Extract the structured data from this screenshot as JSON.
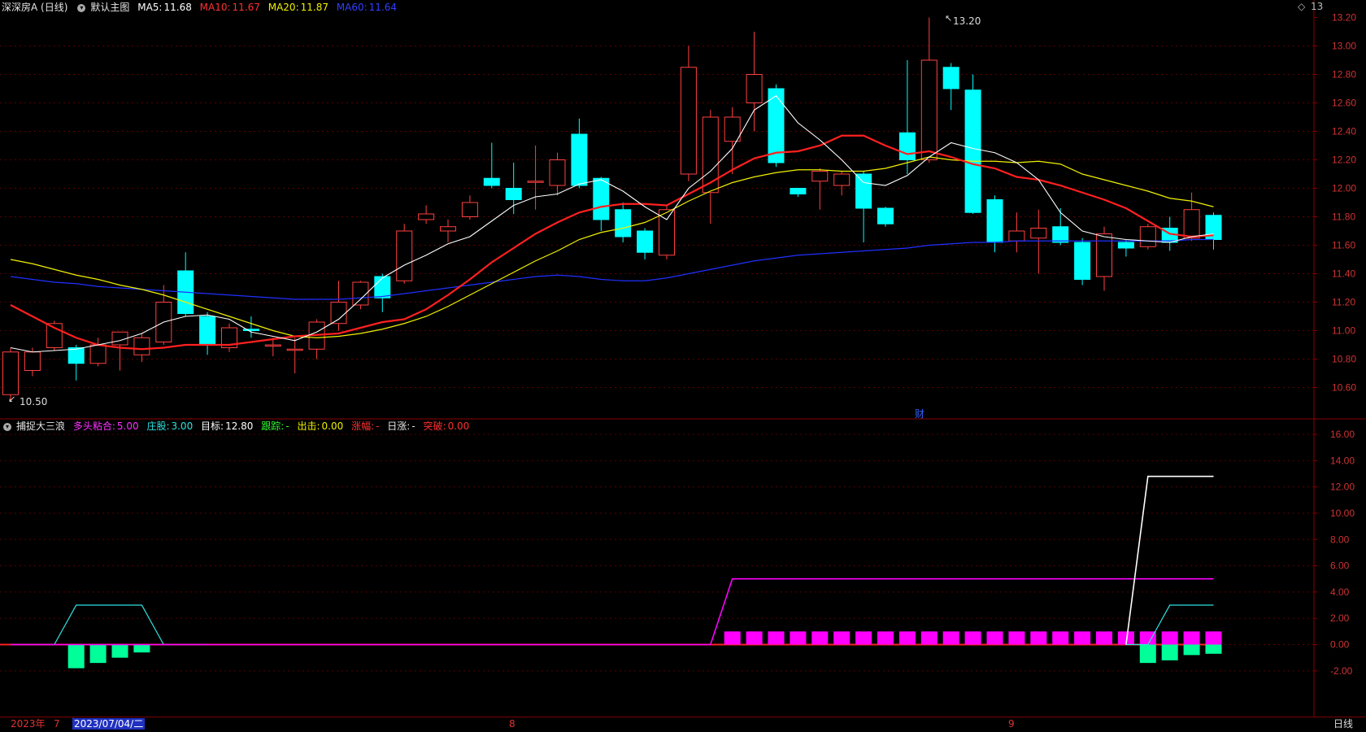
{
  "header": {
    "stock": "深深房A (日线)",
    "main_chart": "默认主图",
    "ma5_label": "MA5:",
    "ma5": "11.68",
    "ma10_label": "MA10:",
    "ma10": "11.67",
    "ma20_label": "MA20:",
    "ma20": "11.87",
    "ma60_label": "MA60:",
    "ma60": "11.64",
    "colors": {
      "ma5": "#ffffff",
      "ma10": "#ff2020",
      "ma20": "#f0f000",
      "ma60": "#2030ff"
    }
  },
  "indicator_header": {
    "name": "捕捉大三浪",
    "duotou_label": "多头粘合:",
    "duotou": "5.00",
    "zhuang_label": "庄股:",
    "zhuang": "3.00",
    "target_label": "目标:",
    "target": "12.80",
    "track_label": "跟踪:",
    "track": "-",
    "out_label": "出击:",
    "out": "0.00",
    "rise_label": "涨幅:",
    "rise": "-",
    "day_label": "日涨:",
    "day": "-",
    "break_label": "突破:",
    "break": "0.00"
  },
  "price_labels": {
    "high": "13.20",
    "low": "10.50",
    "event": "财"
  },
  "top_right": {
    "icon": "diamond-icon",
    "value": "13"
  },
  "bottom_bar": {
    "year": "2023年",
    "m7": "7",
    "date": "2023/07/04/二",
    "m8": "8",
    "m9": "9",
    "period": "日线"
  },
  "chart_data": [
    {
      "type": "candlestick",
      "ylim": [
        10.5,
        13.2
      ],
      "y_ticks": [
        "13.20",
        "13.00",
        "12.80",
        "12.60",
        "12.40",
        "12.20",
        "12.00",
        "11.80",
        "11.60",
        "11.40",
        "11.20",
        "11.00",
        "10.80",
        "10.60"
      ],
      "candles": [
        {
          "o": 10.55,
          "c": 10.85,
          "h": 10.88,
          "l": 10.5
        },
        {
          "o": 10.72,
          "c": 10.85,
          "h": 10.88,
          "l": 10.68
        },
        {
          "o": 10.88,
          "c": 11.05,
          "h": 11.07,
          "l": 10.86
        },
        {
          "o": 10.88,
          "c": 10.77,
          "h": 10.9,
          "l": 10.65
        },
        {
          "o": 10.77,
          "c": 10.9,
          "h": 10.95,
          "l": 10.75
        },
        {
          "o": 10.9,
          "c": 10.99,
          "h": 10.99,
          "l": 10.72
        },
        {
          "o": 10.83,
          "c": 10.95,
          "h": 10.98,
          "l": 10.78
        },
        {
          "o": 10.92,
          "c": 11.2,
          "h": 11.32,
          "l": 10.9
        },
        {
          "o": 11.42,
          "c": 11.12,
          "h": 11.55,
          "l": 11.1
        },
        {
          "o": 11.1,
          "c": 10.9,
          "h": 11.13,
          "l": 10.83
        },
        {
          "o": 10.88,
          "c": 11.02,
          "h": 11.05,
          "l": 10.85
        },
        {
          "o": 11.01,
          "c": 11.0,
          "h": 11.1,
          "l": 10.95
        },
        {
          "o": 10.9,
          "c": 10.9,
          "h": 10.95,
          "l": 10.82
        },
        {
          "o": 10.87,
          "c": 10.87,
          "h": 10.95,
          "l": 10.7
        },
        {
          "o": 10.87,
          "c": 11.06,
          "h": 11.08,
          "l": 10.8
        },
        {
          "o": 11.05,
          "c": 11.2,
          "h": 11.35,
          "l": 11.0
        },
        {
          "o": 11.18,
          "c": 11.34,
          "h": 11.35,
          "l": 11.15
        },
        {
          "o": 11.38,
          "c": 11.23,
          "h": 11.4,
          "l": 11.13
        },
        {
          "o": 11.35,
          "c": 11.7,
          "h": 11.75,
          "l": 11.33
        },
        {
          "o": 11.78,
          "c": 11.82,
          "h": 11.88,
          "l": 11.75
        },
        {
          "o": 11.7,
          "c": 11.73,
          "h": 11.78,
          "l": 11.62
        },
        {
          "o": 11.8,
          "c": 11.9,
          "h": 11.95,
          "l": 11.78
        },
        {
          "o": 12.07,
          "c": 12.02,
          "h": 12.32,
          "l": 12.0
        },
        {
          "o": 12.0,
          "c": 11.92,
          "h": 12.18,
          "l": 11.82
        },
        {
          "o": 12.05,
          "c": 12.05,
          "h": 12.3,
          "l": 11.85
        },
        {
          "o": 12.02,
          "c": 12.2,
          "h": 12.25,
          "l": 11.95
        },
        {
          "o": 12.38,
          "c": 12.02,
          "h": 12.49,
          "l": 12.0
        },
        {
          "o": 12.07,
          "c": 11.78,
          "h": 12.08,
          "l": 11.7
        },
        {
          "o": 11.85,
          "c": 11.66,
          "h": 11.9,
          "l": 11.62
        },
        {
          "o": 11.7,
          "c": 11.55,
          "h": 11.72,
          "l": 11.5
        },
        {
          "o": 11.53,
          "c": 11.85,
          "h": 11.88,
          "l": 11.5
        },
        {
          "o": 12.1,
          "c": 12.85,
          "h": 13.0,
          "l": 12.05
        },
        {
          "o": 11.97,
          "c": 12.5,
          "h": 12.55,
          "l": 11.75
        },
        {
          "o": 12.33,
          "c": 12.5,
          "h": 12.57,
          "l": 12.1
        },
        {
          "o": 12.6,
          "c": 12.8,
          "h": 13.1,
          "l": 12.4
        },
        {
          "o": 12.7,
          "c": 12.18,
          "h": 12.73,
          "l": 12.15
        },
        {
          "o": 12.0,
          "c": 11.96,
          "h": 12.0,
          "l": 11.94
        },
        {
          "o": 12.05,
          "c": 12.12,
          "h": 12.14,
          "l": 11.85
        },
        {
          "o": 12.02,
          "c": 12.1,
          "h": 12.12,
          "l": 11.95
        },
        {
          "o": 12.1,
          "c": 11.86,
          "h": 12.12,
          "l": 11.62
        },
        {
          "o": 11.86,
          "c": 11.75,
          "h": 11.87,
          "l": 11.73
        },
        {
          "o": 12.39,
          "c": 12.2,
          "h": 12.9,
          "l": 12.1
        },
        {
          "o": 12.2,
          "c": 12.9,
          "h": 13.2,
          "l": 12.18
        },
        {
          "o": 12.85,
          "c": 12.7,
          "h": 12.88,
          "l": 12.55
        },
        {
          "o": 12.69,
          "c": 11.83,
          "h": 12.8,
          "l": 11.82
        },
        {
          "o": 11.92,
          "c": 11.62,
          "h": 11.95,
          "l": 11.55
        },
        {
          "o": 11.63,
          "c": 11.7,
          "h": 11.83,
          "l": 11.55
        },
        {
          "o": 11.65,
          "c": 11.72,
          "h": 11.85,
          "l": 11.4
        },
        {
          "o": 11.73,
          "c": 11.62,
          "h": 11.86,
          "l": 11.6
        },
        {
          "o": 11.62,
          "c": 11.36,
          "h": 11.65,
          "l": 11.32
        },
        {
          "o": 11.38,
          "c": 11.68,
          "h": 11.73,
          "l": 11.28
        },
        {
          "o": 11.62,
          "c": 11.58,
          "h": 11.64,
          "l": 11.52
        },
        {
          "o": 11.59,
          "c": 11.73,
          "h": 11.75,
          "l": 11.57
        },
        {
          "o": 11.72,
          "c": 11.62,
          "h": 11.8,
          "l": 11.56
        },
        {
          "o": 11.65,
          "c": 11.85,
          "h": 11.97,
          "l": 11.63
        },
        {
          "o": 11.81,
          "c": 11.64,
          "h": 11.83,
          "l": 11.57
        }
      ],
      "ma5": [
        10.88,
        10.85,
        10.86,
        10.87,
        10.9,
        10.93,
        10.98,
        11.06,
        11.1,
        11.11,
        11.08,
        10.99,
        10.96,
        10.93,
        10.99,
        11.08,
        11.22,
        11.37,
        11.46,
        11.53,
        11.61,
        11.66,
        11.77,
        11.88,
        11.94,
        11.96,
        12.03,
        12.06,
        11.98,
        11.87,
        11.78,
        12.0,
        12.12,
        12.28,
        12.55,
        12.65,
        12.46,
        12.34,
        12.2,
        12.04,
        12.02,
        12.09,
        12.22,
        12.32,
        12.28,
        12.25,
        12.18,
        12.06,
        11.83,
        11.7,
        11.66,
        11.64,
        11.63,
        11.62,
        11.66,
        11.68
      ],
      "ma10": [
        11.18,
        11.1,
        11.02,
        10.95,
        10.9,
        10.88,
        10.87,
        10.88,
        10.9,
        10.9,
        10.9,
        10.92,
        10.94,
        10.96,
        10.97,
        10.98,
        11.02,
        11.06,
        11.08,
        11.15,
        11.25,
        11.36,
        11.48,
        11.58,
        11.68,
        11.76,
        11.83,
        11.87,
        11.89,
        11.89,
        11.88,
        11.96,
        12.04,
        12.13,
        12.21,
        12.25,
        12.26,
        12.3,
        12.37,
        12.37,
        12.3,
        12.24,
        12.26,
        12.22,
        12.17,
        12.14,
        12.08,
        12.06,
        12.02,
        11.97,
        11.92,
        11.86,
        11.77,
        11.68,
        11.66,
        11.67
      ],
      "ma20": [
        11.5,
        11.47,
        11.43,
        11.39,
        11.36,
        11.32,
        11.29,
        11.25,
        11.2,
        11.15,
        11.1,
        11.05,
        11.0,
        10.96,
        10.95,
        10.96,
        10.98,
        11.01,
        11.05,
        11.1,
        11.17,
        11.25,
        11.33,
        11.41,
        11.49,
        11.56,
        11.64,
        11.69,
        11.72,
        11.76,
        11.83,
        11.91,
        11.98,
        12.04,
        12.08,
        12.11,
        12.13,
        12.13,
        12.12,
        12.12,
        12.14,
        12.18,
        12.22,
        12.2,
        12.19,
        12.19,
        12.18,
        12.19,
        12.17,
        12.1,
        12.06,
        12.02,
        11.98,
        11.93,
        11.91,
        11.87
      ],
      "ma60": [
        11.38,
        11.36,
        11.34,
        11.33,
        11.31,
        11.3,
        11.29,
        11.28,
        11.27,
        11.26,
        11.25,
        11.24,
        11.23,
        11.22,
        11.22,
        11.22,
        11.23,
        11.24,
        11.26,
        11.28,
        11.3,
        11.32,
        11.34,
        11.36,
        11.38,
        11.39,
        11.38,
        11.36,
        11.35,
        11.35,
        11.37,
        11.4,
        11.43,
        11.46,
        11.49,
        11.51,
        11.53,
        11.54,
        11.55,
        11.56,
        11.57,
        11.58,
        11.6,
        11.61,
        11.62,
        11.62,
        11.63,
        11.63,
        11.63,
        11.63,
        11.63,
        11.63,
        11.63,
        11.63,
        11.64,
        11.64
      ]
    },
    {
      "type": "indicator",
      "ylim": [
        -4,
        17
      ],
      "y_ticks": [
        "16.00",
        "14.00",
        "12.00",
        "10.00",
        "8.00",
        "6.00",
        "4.00",
        "2.00",
        "0.00",
        "-2.00"
      ],
      "magenta_line": [
        0,
        0,
        0,
        0,
        0,
        0,
        0,
        0,
        0,
        0,
        0,
        0,
        0,
        0,
        0,
        0,
        0,
        0,
        0,
        0,
        0,
        0,
        0,
        0,
        0,
        0,
        0,
        0,
        0,
        0,
        0,
        0,
        0,
        5,
        5,
        5,
        5,
        5,
        5,
        5,
        5,
        5,
        5,
        5,
        5,
        5,
        5,
        5,
        5,
        5,
        5,
        5,
        5,
        5,
        5,
        5
      ],
      "cyan_line": [
        0,
        0,
        0,
        3,
        3,
        3,
        3,
        0,
        0,
        0,
        0,
        0,
        0,
        0,
        0,
        0,
        0,
        0,
        0,
        0,
        0,
        0,
        0,
        0,
        0,
        0,
        0,
        0,
        0,
        0,
        0,
        0,
        0,
        0,
        0,
        0,
        0,
        0,
        0,
        0,
        0,
        0,
        0,
        0,
        0,
        0,
        0,
        0,
        0,
        0,
        0,
        0,
        0,
        3,
        3,
        3
      ],
      "white_line": [
        0,
        0,
        0,
        0,
        0,
        0,
        0,
        0,
        0,
        0,
        0,
        0,
        0,
        0,
        0,
        0,
        0,
        0,
        0,
        0,
        0,
        0,
        0,
        0,
        0,
        0,
        0,
        0,
        0,
        0,
        0,
        0,
        0,
        0,
        0,
        0,
        0,
        0,
        0,
        0,
        0,
        0,
        0,
        0,
        0,
        0,
        0,
        0,
        0,
        0,
        0,
        0,
        12.8,
        12.8,
        12.8,
        12.8
      ],
      "magenta_bars": [
        0,
        0,
        0,
        0,
        0,
        0,
        0,
        0,
        0,
        0,
        0,
        0,
        0,
        0,
        0,
        0,
        0,
        0,
        0,
        0,
        0,
        0,
        0,
        0,
        0,
        0,
        0,
        0,
        0,
        0,
        0,
        0,
        0,
        1,
        1,
        1,
        1,
        1,
        1,
        1,
        1,
        1,
        1,
        1,
        1,
        1,
        1,
        1,
        1,
        1,
        1,
        1,
        1,
        1,
        1,
        1
      ],
      "green_bars": [
        0,
        0,
        0,
        -1.8,
        -1.4,
        -1.0,
        -0.6,
        0,
        0,
        0,
        0,
        0,
        0,
        0,
        0,
        0,
        0,
        0,
        0,
        0,
        0,
        0,
        0,
        0,
        0,
        0,
        0,
        0,
        0,
        0,
        0,
        0,
        0,
        0,
        0,
        0,
        0,
        0,
        0,
        0,
        0,
        0,
        0,
        0,
        0,
        0,
        0,
        0,
        0,
        0,
        0,
        0,
        -1.4,
        -1.2,
        -0.8,
        -0.7
      ]
    }
  ]
}
